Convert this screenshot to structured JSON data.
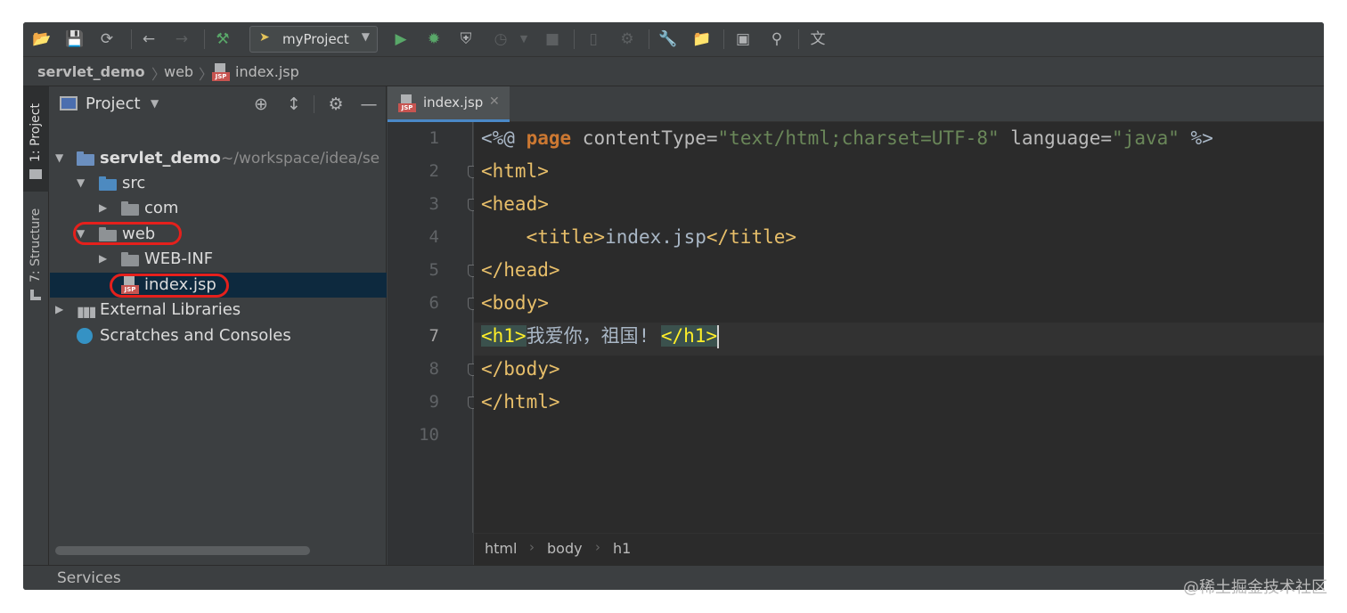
{
  "toolbar": {
    "run_config": "myProject",
    "icons": [
      "open-folder-icon",
      "save-icon",
      "sync-icon",
      "back-icon",
      "forward-icon",
      "build-hammer-icon",
      "run-icon",
      "debug-icon",
      "coverage-icon",
      "profile-icon",
      "stop-icon",
      "device-icon",
      "attach-icon",
      "settings-wrench-icon",
      "project-structure-icon",
      "terminal-icon",
      "search-icon",
      "translate-icon"
    ]
  },
  "navbar": {
    "crumbs": [
      "servlet_demo",
      "web",
      "index.jsp"
    ]
  },
  "stripe": {
    "project_tab": "1: Project",
    "structure_tab": "7: Structure"
  },
  "project_panel": {
    "title": "Project",
    "tree": {
      "root": "servlet_demo",
      "root_path": "~/workspace/idea/se",
      "src": "src",
      "com": "com",
      "web": "web",
      "webinf": "WEB-INF",
      "index": "index.jsp",
      "libs": "External Libraries",
      "scratches": "Scratches and Consoles"
    }
  },
  "editor": {
    "tab_label": "index.jsp",
    "line_numbers": [
      "1",
      "2",
      "3",
      "4",
      "5",
      "6",
      "7",
      "8",
      "9",
      "10"
    ],
    "current_line": "7",
    "code": {
      "l1": {
        "open": "<%@ ",
        "kw": "page",
        "a1": " contentType=",
        "s1": "\"text/html;charset=UTF-8\"",
        "a2": " language=",
        "s2": "\"java\"",
        "close": " %>"
      },
      "l2": "<html>",
      "l3": "<head>",
      "l4": {
        "open": "    <title>",
        "text": "index.jsp",
        "close": "</title>"
      },
      "l5": "</head>",
      "l6": "<body>",
      "l7": {
        "open": "<h1>",
        "text": "我爱你，祖国! ",
        "close": "</h1>"
      },
      "l8": "</body>",
      "l9": "</html>"
    },
    "breadcrumbs": [
      "html",
      "body",
      "h1"
    ]
  },
  "statusbar": {
    "services": "Services"
  },
  "watermark": "@稀土掘金技术社区",
  "colors": {
    "tag": "#e8bf6a",
    "keyword": "#cc7832",
    "string": "#6a8759",
    "highlight_ring": "#e5201c"
  }
}
